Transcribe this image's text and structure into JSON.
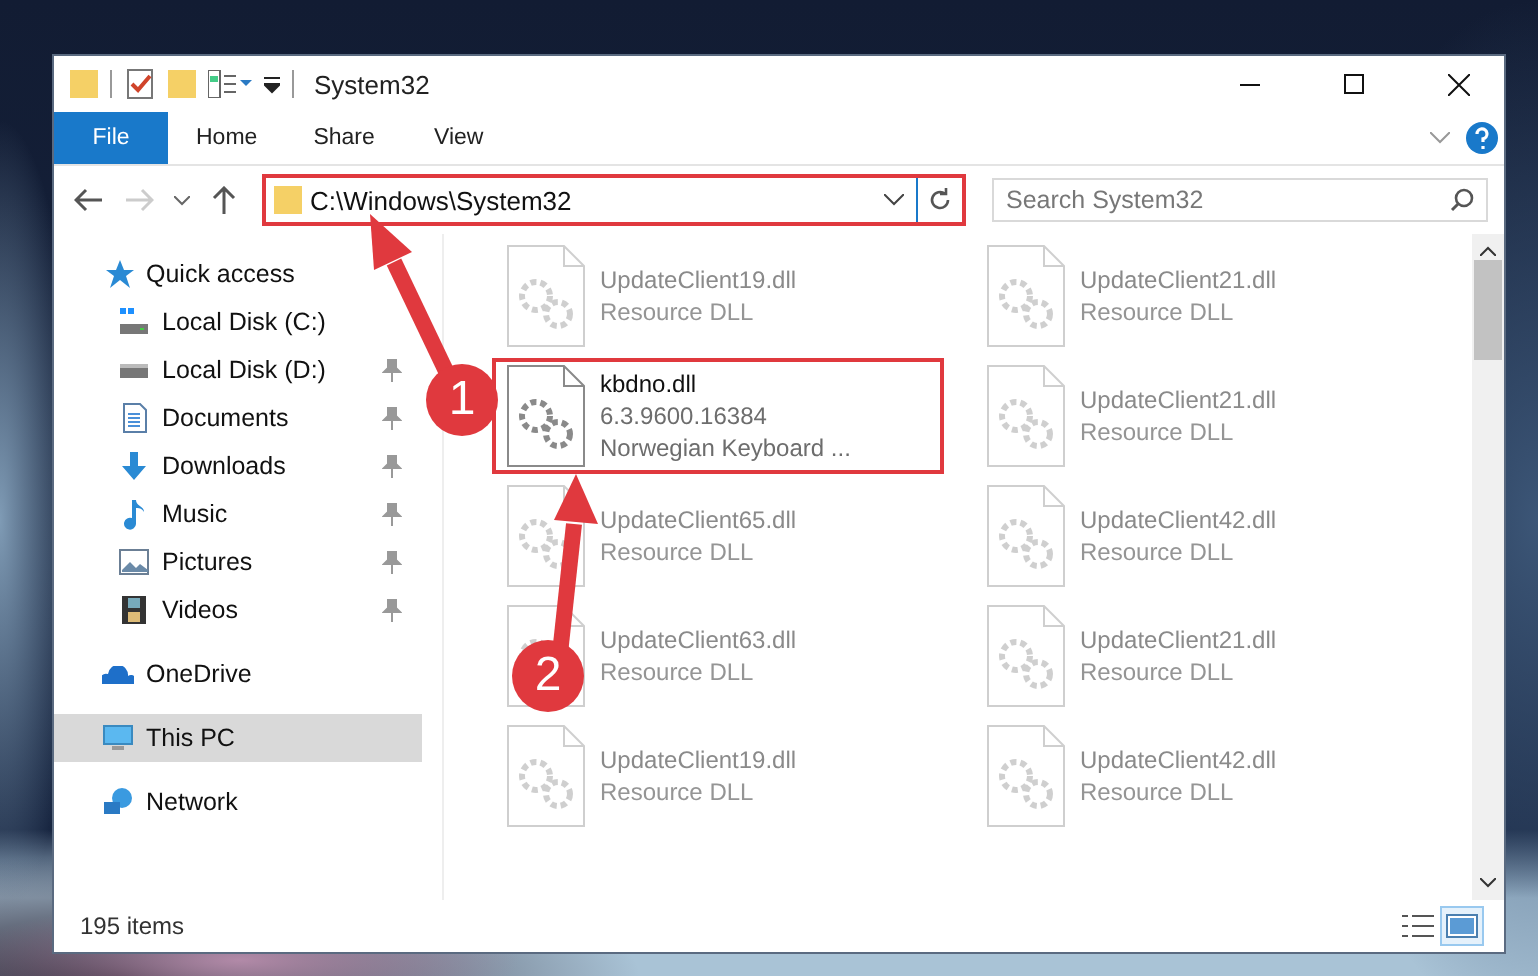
{
  "window": {
    "title": "System32"
  },
  "ribbon_tabs": [
    {
      "label": "File",
      "kind": "file"
    },
    {
      "label": "Home",
      "kind": "tab"
    },
    {
      "label": "Share",
      "kind": "tab"
    },
    {
      "label": "View",
      "kind": "tab"
    }
  ],
  "address_bar": {
    "path": "C:\\Windows\\System32",
    "highlighted": true
  },
  "search": {
    "placeholder": "Search System32"
  },
  "sidebar": {
    "items": [
      {
        "label": "Quick access",
        "kind": "star",
        "selected": false,
        "children": [
          {
            "label": "Local Disk (C:)",
            "kind": "system-drive",
            "pinned": false,
            "selected": false
          },
          {
            "label": "Local Disk (D:)",
            "kind": "drive",
            "pinned": true,
            "selected": false
          },
          {
            "label": "Documents",
            "kind": "documents",
            "pinned": true,
            "selected": false
          },
          {
            "label": "Downloads",
            "kind": "downloads",
            "pinned": true,
            "selected": false
          },
          {
            "label": "Music",
            "kind": "music",
            "pinned": true,
            "selected": false
          },
          {
            "label": "Pictures",
            "kind": "pictures",
            "pinned": true,
            "selected": false
          },
          {
            "label": "Videos",
            "kind": "videos",
            "pinned": true,
            "selected": false
          }
        ]
      },
      {
        "label": "OneDrive",
        "kind": "cloud",
        "selected": false
      },
      {
        "label": "This PC",
        "kind": "pc",
        "selected": true
      },
      {
        "label": "Network",
        "kind": "network",
        "selected": false
      }
    ]
  },
  "files": [
    {
      "name": "UpdateClient19.dll",
      "lines": [
        "Resource DLL"
      ],
      "dimmed": true,
      "highlighted": false
    },
    {
      "name": "UpdateClient21.dll",
      "lines": [
        "Resource DLL"
      ],
      "dimmed": true,
      "highlighted": false
    },
    {
      "name": "kbdno.dll",
      "lines": [
        "6.3.9600.16384",
        "Norwegian Keyboard ..."
      ],
      "dimmed": false,
      "highlighted": true
    },
    {
      "name": "UpdateClient21.dll",
      "lines": [
        "Resource DLL"
      ],
      "dimmed": true,
      "highlighted": false
    },
    {
      "name": "UpdateClient65.dll",
      "lines": [
        "Resource DLL"
      ],
      "dimmed": true,
      "highlighted": false
    },
    {
      "name": "UpdateClient42.dll",
      "lines": [
        "Resource DLL"
      ],
      "dimmed": true,
      "highlighted": false
    },
    {
      "name": "UpdateClient63.dll",
      "lines": [
        "Resource DLL"
      ],
      "dimmed": true,
      "highlighted": false
    },
    {
      "name": "UpdateClient21.dll",
      "lines": [
        "Resource DLL"
      ],
      "dimmed": true,
      "highlighted": false
    },
    {
      "name": "UpdateClient19.dll",
      "lines": [
        "Resource DLL"
      ],
      "dimmed": true,
      "highlighted": false
    },
    {
      "name": "UpdateClient42.dll",
      "lines": [
        "Resource DLL"
      ],
      "dimmed": true,
      "highlighted": false
    }
  ],
  "status_bar": {
    "text": "195 items",
    "views": [
      {
        "kind": "details",
        "selected": false
      },
      {
        "kind": "large-icons",
        "selected": true
      }
    ]
  },
  "callouts": [
    {
      "number": "1"
    },
    {
      "number": "2"
    }
  ]
}
